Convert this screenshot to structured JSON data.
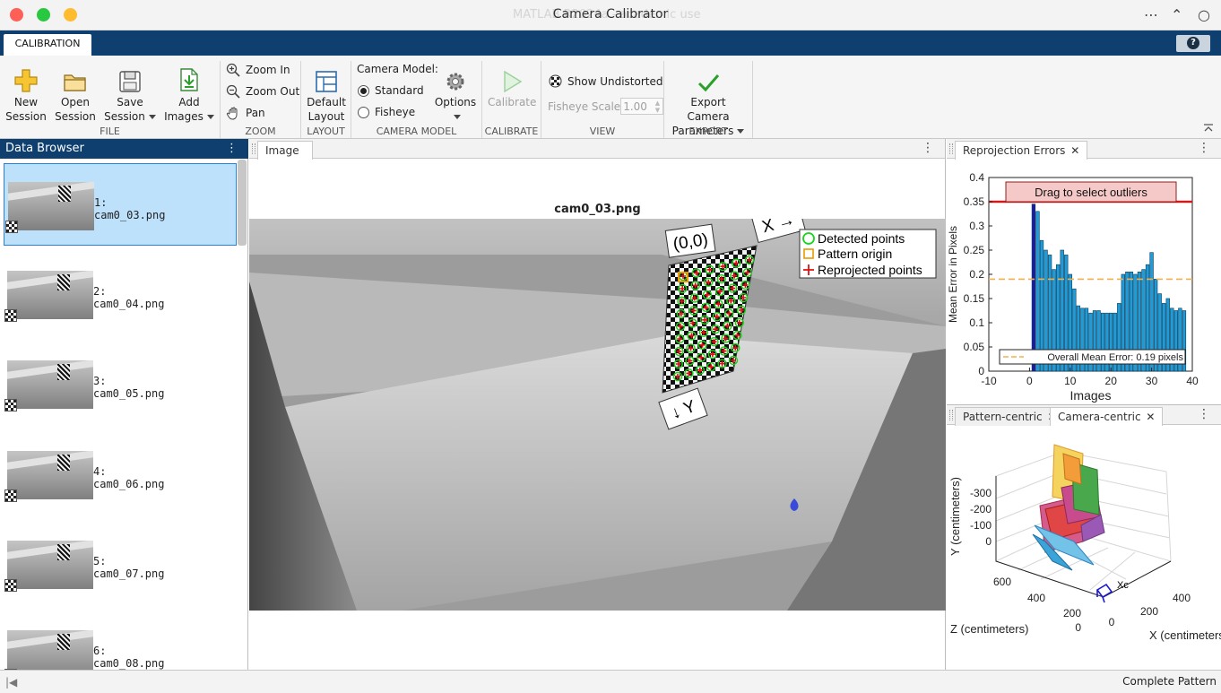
{
  "window": {
    "title": "Camera Calibrator",
    "ghost_title": "MATLAB R2024a - academic use",
    "more": "⋯",
    "minimize": "⌃",
    "restore": "○"
  },
  "ribbon": {
    "tab": "CALIBRATION",
    "help": "?",
    "file": {
      "label": "FILE",
      "new_session": [
        "New",
        "Session"
      ],
      "open_session": [
        "Open",
        "Session"
      ],
      "save_session": [
        "Save",
        "Session"
      ],
      "add_images": [
        "Add",
        "Images"
      ]
    },
    "zoom": {
      "label": "ZOOM",
      "zoom_in": "Zoom In",
      "zoom_out": "Zoom Out",
      "pan": "Pan"
    },
    "layout": {
      "label": "LAYOUT",
      "default_layout": [
        "Default",
        "Layout"
      ]
    },
    "camera_model": {
      "label": "CAMERA MODEL",
      "title": "Camera Model:",
      "standard": "Standard",
      "fisheye": "Fisheye",
      "selected": "Standard",
      "options": "Options"
    },
    "calibrate": {
      "label": "CALIBRATE",
      "button": "Calibrate"
    },
    "view": {
      "label": "VIEW",
      "show_undistorted": "Show Undistorted",
      "fisheye_scale_label": "Fisheye Scale",
      "fisheye_scale_value": "1.00"
    },
    "export": {
      "label": "EXPORT",
      "button": [
        "Export Camera",
        "Parameters"
      ]
    }
  },
  "browser": {
    "title": "Data Browser",
    "selected_index": 0,
    "items": [
      {
        "num": "1:",
        "name": "cam0_03.png"
      },
      {
        "num": "2:",
        "name": "cam0_04.png"
      },
      {
        "num": "3:",
        "name": "cam0_05.png"
      },
      {
        "num": "4:",
        "name": "cam0_06.png"
      },
      {
        "num": "5:",
        "name": "cam0_07.png"
      },
      {
        "num": "6:",
        "name": "cam0_08.png"
      }
    ]
  },
  "image_view": {
    "tab": "Image",
    "title": "cam0_03.png",
    "origin_label": "(0,0)",
    "x_label": "X →",
    "y_label": "↓ Y",
    "legend": [
      "Detected points",
      "Pattern origin",
      "Reprojected points"
    ]
  },
  "reprojection": {
    "tab": "Reprojection Errors",
    "drag_hint": "Drag to select outliers",
    "overall_label": "Overall Mean Error: 0.19 pixels",
    "overall_mean": 0.19,
    "threshold": 0.35
  },
  "extrinsics": {
    "tab_pattern": "Pattern-centric",
    "tab_camera": "Camera-centric",
    "ylabel": "Y (centimeters)",
    "zlabel": "Z (centimeters)",
    "xlabel": "X (centimeters)",
    "camera_label": "Xc",
    "y_ticks": [
      "-300",
      "-200",
      "-100",
      "0"
    ],
    "z_ticks": [
      "600",
      "400",
      "200",
      "0"
    ],
    "x_ticks": [
      "0",
      "200",
      "400"
    ]
  },
  "status": {
    "text": "Complete Pattern"
  },
  "colors": {
    "ribbon_blue": "#0e3f6e",
    "bar_blue": "#1f9bd7",
    "selected_bar": "#1a1aa8",
    "threshold_red": "#d11b1b",
    "mean_line": "#f2b04b",
    "detected_green": "#19d419",
    "origin_orange": "#e89a00",
    "reproj_red": "#e01010"
  },
  "chart_data": {
    "type": "bar",
    "title": "",
    "xlabel": "Images",
    "ylabel": "Mean Error in Pixels",
    "xlim": [
      -10,
      40
    ],
    "ylim": [
      0,
      0.4
    ],
    "xticks": [
      -10,
      0,
      10,
      20,
      30,
      40
    ],
    "yticks": [
      0,
      0.05,
      0.1,
      0.15,
      0.2,
      0.25,
      0.3,
      0.35,
      0.4
    ],
    "x": [
      1,
      2,
      3,
      4,
      5,
      6,
      7,
      8,
      9,
      10,
      11,
      12,
      13,
      14,
      15,
      16,
      17,
      18,
      19,
      20,
      21,
      22,
      23,
      24,
      25,
      26,
      27,
      28,
      29,
      30,
      31,
      32,
      33,
      34,
      35,
      36,
      37,
      38
    ],
    "values": [
      0.345,
      0.33,
      0.27,
      0.25,
      0.24,
      0.21,
      0.22,
      0.25,
      0.24,
      0.2,
      0.17,
      0.135,
      0.13,
      0.13,
      0.12,
      0.125,
      0.125,
      0.12,
      0.12,
      0.12,
      0.12,
      0.14,
      0.2,
      0.205,
      0.205,
      0.2,
      0.205,
      0.21,
      0.22,
      0.245,
      0.19,
      0.16,
      0.14,
      0.15,
      0.13,
      0.125,
      0.13,
      0.125
    ],
    "selected_index": 0,
    "overall_mean": 0.19,
    "grid": false,
    "legend": "bottom"
  }
}
